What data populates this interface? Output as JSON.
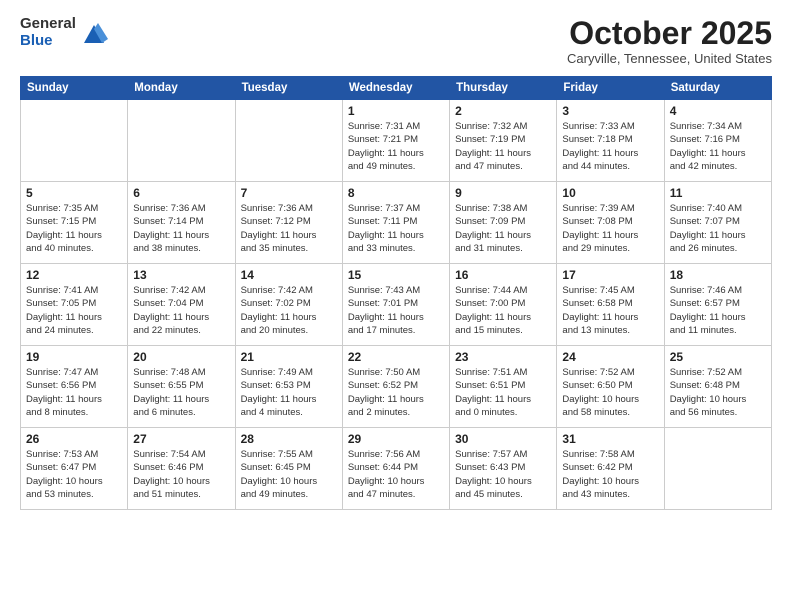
{
  "header": {
    "logo_general": "General",
    "logo_blue": "Blue",
    "month_title": "October 2025",
    "location": "Caryville, Tennessee, United States"
  },
  "weekdays": [
    "Sunday",
    "Monday",
    "Tuesday",
    "Wednesday",
    "Thursday",
    "Friday",
    "Saturday"
  ],
  "weeks": [
    [
      {
        "day": "",
        "info": ""
      },
      {
        "day": "",
        "info": ""
      },
      {
        "day": "",
        "info": ""
      },
      {
        "day": "1",
        "info": "Sunrise: 7:31 AM\nSunset: 7:21 PM\nDaylight: 11 hours\nand 49 minutes."
      },
      {
        "day": "2",
        "info": "Sunrise: 7:32 AM\nSunset: 7:19 PM\nDaylight: 11 hours\nand 47 minutes."
      },
      {
        "day": "3",
        "info": "Sunrise: 7:33 AM\nSunset: 7:18 PM\nDaylight: 11 hours\nand 44 minutes."
      },
      {
        "day": "4",
        "info": "Sunrise: 7:34 AM\nSunset: 7:16 PM\nDaylight: 11 hours\nand 42 minutes."
      }
    ],
    [
      {
        "day": "5",
        "info": "Sunrise: 7:35 AM\nSunset: 7:15 PM\nDaylight: 11 hours\nand 40 minutes."
      },
      {
        "day": "6",
        "info": "Sunrise: 7:36 AM\nSunset: 7:14 PM\nDaylight: 11 hours\nand 38 minutes."
      },
      {
        "day": "7",
        "info": "Sunrise: 7:36 AM\nSunset: 7:12 PM\nDaylight: 11 hours\nand 35 minutes."
      },
      {
        "day": "8",
        "info": "Sunrise: 7:37 AM\nSunset: 7:11 PM\nDaylight: 11 hours\nand 33 minutes."
      },
      {
        "day": "9",
        "info": "Sunrise: 7:38 AM\nSunset: 7:09 PM\nDaylight: 11 hours\nand 31 minutes."
      },
      {
        "day": "10",
        "info": "Sunrise: 7:39 AM\nSunset: 7:08 PM\nDaylight: 11 hours\nand 29 minutes."
      },
      {
        "day": "11",
        "info": "Sunrise: 7:40 AM\nSunset: 7:07 PM\nDaylight: 11 hours\nand 26 minutes."
      }
    ],
    [
      {
        "day": "12",
        "info": "Sunrise: 7:41 AM\nSunset: 7:05 PM\nDaylight: 11 hours\nand 24 minutes."
      },
      {
        "day": "13",
        "info": "Sunrise: 7:42 AM\nSunset: 7:04 PM\nDaylight: 11 hours\nand 22 minutes."
      },
      {
        "day": "14",
        "info": "Sunrise: 7:42 AM\nSunset: 7:02 PM\nDaylight: 11 hours\nand 20 minutes."
      },
      {
        "day": "15",
        "info": "Sunrise: 7:43 AM\nSunset: 7:01 PM\nDaylight: 11 hours\nand 17 minutes."
      },
      {
        "day": "16",
        "info": "Sunrise: 7:44 AM\nSunset: 7:00 PM\nDaylight: 11 hours\nand 15 minutes."
      },
      {
        "day": "17",
        "info": "Sunrise: 7:45 AM\nSunset: 6:58 PM\nDaylight: 11 hours\nand 13 minutes."
      },
      {
        "day": "18",
        "info": "Sunrise: 7:46 AM\nSunset: 6:57 PM\nDaylight: 11 hours\nand 11 minutes."
      }
    ],
    [
      {
        "day": "19",
        "info": "Sunrise: 7:47 AM\nSunset: 6:56 PM\nDaylight: 11 hours\nand 8 minutes."
      },
      {
        "day": "20",
        "info": "Sunrise: 7:48 AM\nSunset: 6:55 PM\nDaylight: 11 hours\nand 6 minutes."
      },
      {
        "day": "21",
        "info": "Sunrise: 7:49 AM\nSunset: 6:53 PM\nDaylight: 11 hours\nand 4 minutes."
      },
      {
        "day": "22",
        "info": "Sunrise: 7:50 AM\nSunset: 6:52 PM\nDaylight: 11 hours\nand 2 minutes."
      },
      {
        "day": "23",
        "info": "Sunrise: 7:51 AM\nSunset: 6:51 PM\nDaylight: 11 hours\nand 0 minutes."
      },
      {
        "day": "24",
        "info": "Sunrise: 7:52 AM\nSunset: 6:50 PM\nDaylight: 10 hours\nand 58 minutes."
      },
      {
        "day": "25",
        "info": "Sunrise: 7:52 AM\nSunset: 6:48 PM\nDaylight: 10 hours\nand 56 minutes."
      }
    ],
    [
      {
        "day": "26",
        "info": "Sunrise: 7:53 AM\nSunset: 6:47 PM\nDaylight: 10 hours\nand 53 minutes."
      },
      {
        "day": "27",
        "info": "Sunrise: 7:54 AM\nSunset: 6:46 PM\nDaylight: 10 hours\nand 51 minutes."
      },
      {
        "day": "28",
        "info": "Sunrise: 7:55 AM\nSunset: 6:45 PM\nDaylight: 10 hours\nand 49 minutes."
      },
      {
        "day": "29",
        "info": "Sunrise: 7:56 AM\nSunset: 6:44 PM\nDaylight: 10 hours\nand 47 minutes."
      },
      {
        "day": "30",
        "info": "Sunrise: 7:57 AM\nSunset: 6:43 PM\nDaylight: 10 hours\nand 45 minutes."
      },
      {
        "day": "31",
        "info": "Sunrise: 7:58 AM\nSunset: 6:42 PM\nDaylight: 10 hours\nand 43 minutes."
      },
      {
        "day": "",
        "info": ""
      }
    ]
  ]
}
